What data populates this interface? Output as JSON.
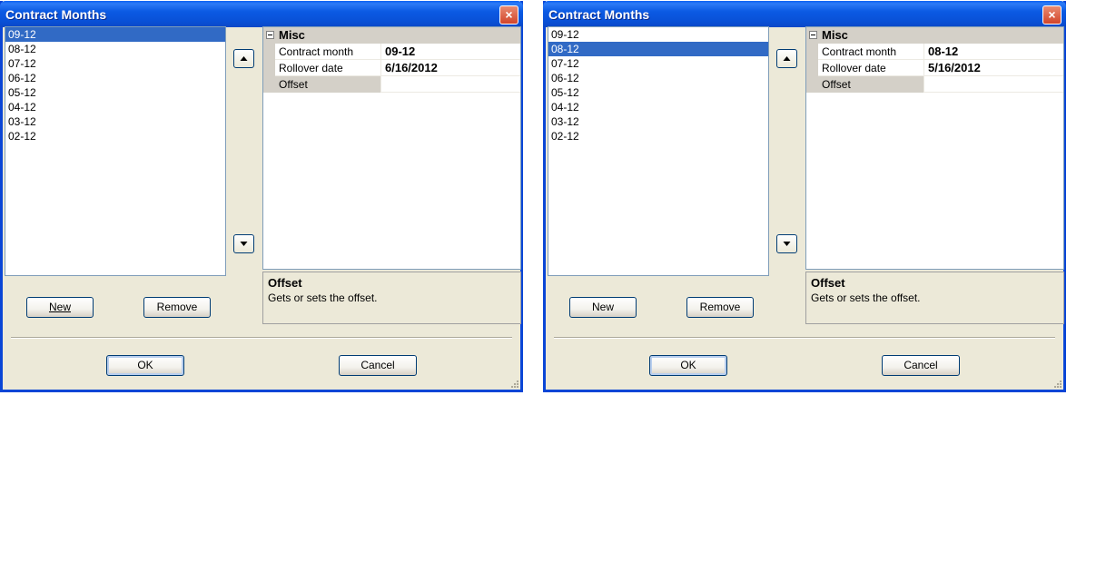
{
  "dialogs": [
    {
      "title": "Contract Months",
      "close_label": "×",
      "list_items": [
        "09-12",
        "08-12",
        "07-12",
        "06-12",
        "05-12",
        "04-12",
        "03-12",
        "02-12"
      ],
      "selected_index": 0,
      "property_category": "Misc",
      "properties": [
        {
          "name": "Contract month",
          "value": "09-12"
        },
        {
          "name": "Rollover date",
          "value": "6/16/2012"
        },
        {
          "name": "Offset",
          "value": ""
        }
      ],
      "selected_property": "Offset",
      "description_title": "Offset",
      "description_text": "Gets or sets the offset.",
      "new_label": "New",
      "remove_label": "Remove",
      "ok_label": "OK",
      "cancel_label": "Cancel"
    },
    {
      "title": "Contract Months",
      "close_label": "×",
      "list_items": [
        "09-12",
        "08-12",
        "07-12",
        "06-12",
        "05-12",
        "04-12",
        "03-12",
        "02-12"
      ],
      "selected_index": 1,
      "property_category": "Misc",
      "properties": [
        {
          "name": "Contract month",
          "value": "08-12"
        },
        {
          "name": "Rollover date",
          "value": "5/16/2012"
        },
        {
          "name": "Offset",
          "value": ""
        }
      ],
      "selected_property": "Offset",
      "description_title": "Offset",
      "description_text": "Gets or sets the offset.",
      "new_label": "New",
      "remove_label": "Remove",
      "ok_label": "OK",
      "cancel_label": "Cancel"
    }
  ],
  "colors": {
    "titlebar": "#0a5ae3",
    "selection": "#316ac5",
    "dialog_face": "#ece9d8"
  }
}
